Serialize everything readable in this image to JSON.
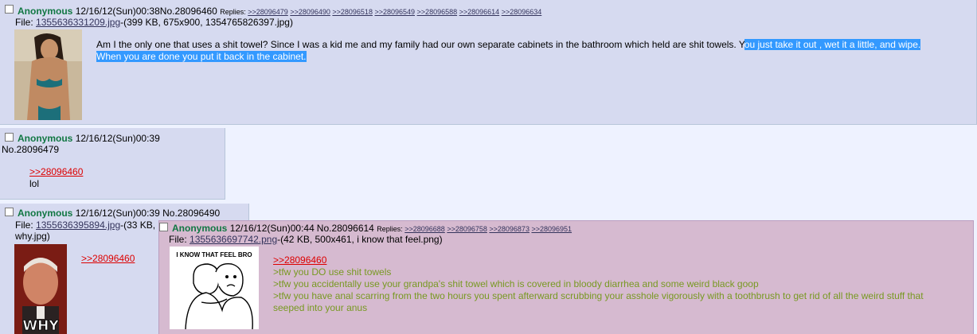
{
  "op": {
    "name": "Anonymous",
    "datetime": "12/16/12(Sun)00:38",
    "no": "No.28096460",
    "replies_label": "Replies:",
    "replies": [
      ">>28096479",
      ">>28096490",
      ">>28096518",
      ">>28096549",
      ">>28096588",
      ">>28096614",
      ">>28096634"
    ],
    "file_label": "File:",
    "file_link": "1355636331209.jpg",
    "file_info": "-(399 KB, 675x900, 1354765826397.jpg)",
    "body_1": "Am I the only one that uses a shit towel? Since I was a kid me and my family had our own separate cabinets in the bathroom which held are shit towels. Y",
    "body_1_sel": "ou just take it out , wet it a little, and wipe.",
    "body_2_sel": "When you are done you put it back in the cabinet."
  },
  "reply1": {
    "name": "Anonymous",
    "datetime": "12/16/12(Sun)00:39",
    "no": "No.28096479",
    "quotelink": ">>28096460",
    "text": "lol"
  },
  "reply2": {
    "name": "Anonymous",
    "datetime": "12/16/12(Sun)00:39",
    "no": "No.28096490",
    "file_label": "File:",
    "file_link": "1355636395894.jpg",
    "file_info": "-(33 KB,",
    "file_info_2": "why.jpg)",
    "quotelink": ">>28096460",
    "thumb_text": "WHY"
  },
  "reply3": {
    "name": "Anonymous",
    "datetime": "12/16/12(Sun)00:44",
    "no": "No.28096614",
    "replies_label": "Replies:",
    "replies": [
      ">>28096688",
      ">>28096758",
      ">>28096873",
      ">>28096951"
    ],
    "file_label": "File:",
    "file_link": "1355636697742.png",
    "file_info": "-(42 KB, 500x461, i know that feel.png)",
    "thumb_text": "I KNOW THAT FEEL BRO",
    "quotelink": ">>28096460",
    "lines": [
      ">tfw you DO use shit towels",
      ">tfw you accidentally use your grandpa's shit towel which is covered in bloody diarrhea and some weird black goop",
      ">tfw you have anal scarring from the two hours you spent afterward scrubbing your asshole vigorously with a toothbrush to get rid of all the weird stuff that",
      "seeped into your anus"
    ]
  }
}
